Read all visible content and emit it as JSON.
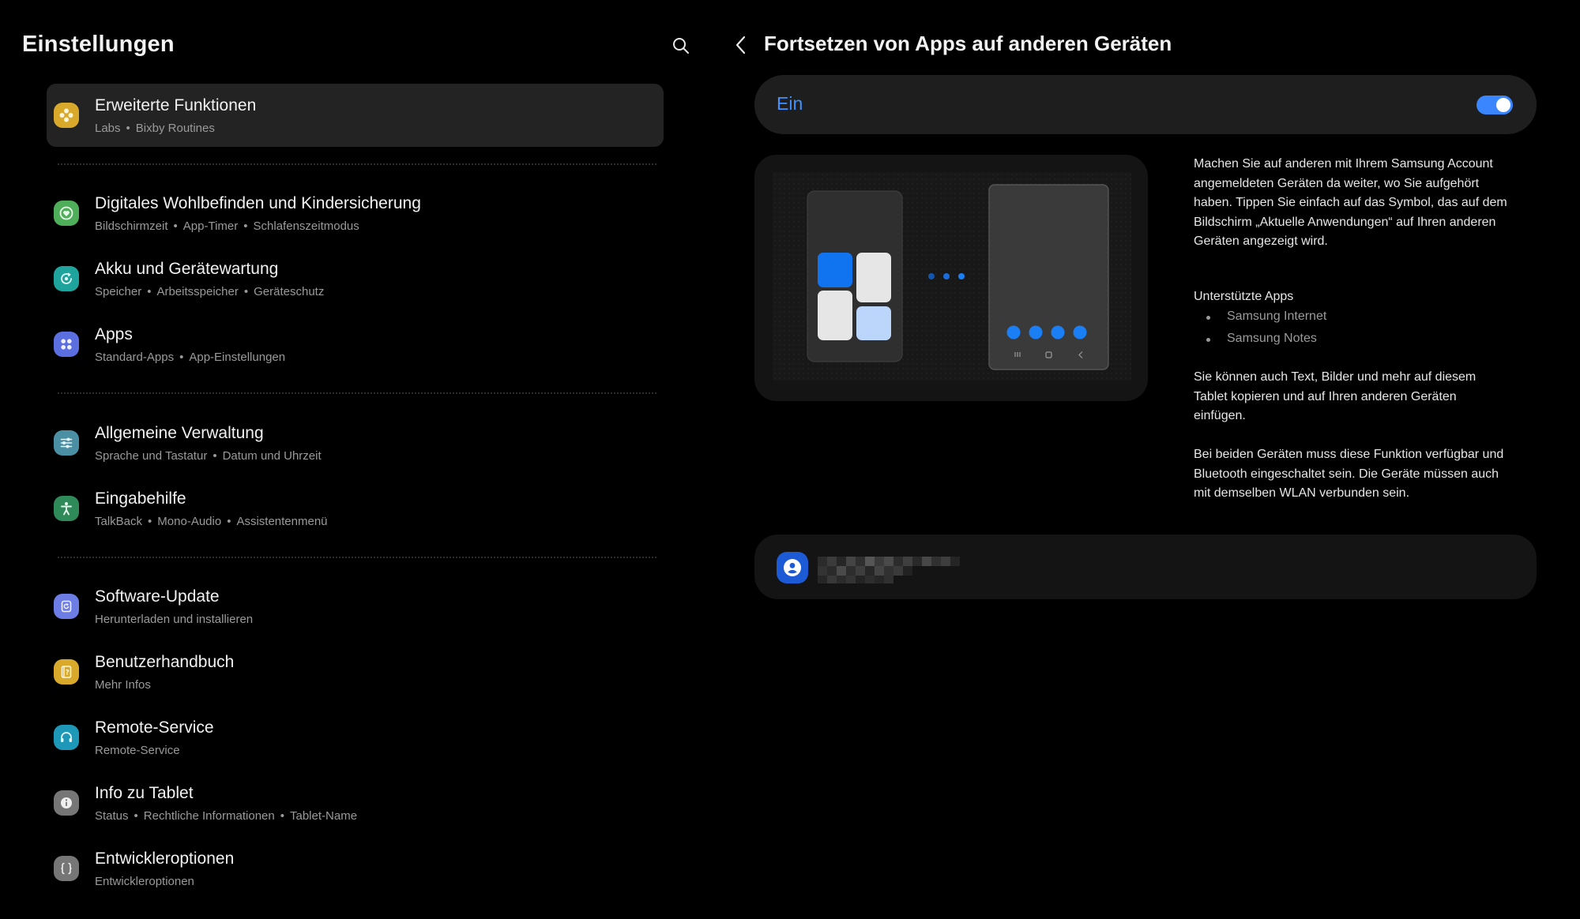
{
  "left": {
    "title": "Einstellungen",
    "search_icon": "search-icon",
    "items": [
      {
        "name": "erweiterte-funktionen",
        "title": "Erweiterte Funktionen",
        "subs": [
          "Labs",
          "Bixby Routines"
        ],
        "icon": "gear-flower-icon",
        "color": "#d9a92c",
        "selected": true
      },
      {
        "name": "digitales-wohlbefinden",
        "title": "Digitales Wohlbefinden und Kindersicherung",
        "subs": [
          "Bildschirmzeit",
          "App-Timer",
          "Schlafenszeitmodus"
        ],
        "icon": "heart-circle-icon",
        "color": "#4fae5a",
        "selected": false
      },
      {
        "name": "akku",
        "title": "Akku und Gerätewartung",
        "subs": [
          "Speicher",
          "Arbeitsspeicher",
          "Geräteschutz"
        ],
        "icon": "device-care-icon",
        "color": "#1fa39d",
        "selected": false
      },
      {
        "name": "apps",
        "title": "Apps",
        "subs": [
          "Standard-Apps",
          "App-Einstellungen"
        ],
        "icon": "apps-grid-icon",
        "color": "#5b6fe0",
        "selected": false
      },
      {
        "name": "allgemeine-verwaltung",
        "title": "Allgemeine Verwaltung",
        "subs": [
          "Sprache und Tastatur",
          "Datum und Uhrzeit"
        ],
        "icon": "sliders-icon",
        "color": "#4a8fa3",
        "selected": false
      },
      {
        "name": "eingabehilfe",
        "title": "Eingabehilfe",
        "subs": [
          "TalkBack",
          "Mono-Audio",
          "Assistentenmenü"
        ],
        "icon": "accessibility-icon",
        "color": "#2f8a5a",
        "selected": false
      },
      {
        "name": "software-update",
        "title": "Software-Update",
        "subs": [
          "Herunterladen und installieren"
        ],
        "icon": "update-icon",
        "color": "#6d7de6",
        "selected": false
      },
      {
        "name": "benutzerhandbuch",
        "title": "Benutzerhandbuch",
        "subs": [
          "Mehr Infos"
        ],
        "icon": "manual-book-icon",
        "color": "#d9a92c",
        "selected": false
      },
      {
        "name": "remote-service",
        "title": "Remote-Service",
        "subs": [
          "Remote-Service"
        ],
        "icon": "headset-icon",
        "color": "#1e98b8",
        "selected": false
      },
      {
        "name": "info-zu-tablet",
        "title": "Info zu Tablet",
        "subs": [
          "Status",
          "Rechtliche Informationen",
          "Tablet-Name"
        ],
        "icon": "info-icon",
        "color": "#767676",
        "selected": false
      },
      {
        "name": "entwickleroptionen",
        "title": "Entwickleroptionen",
        "subs": [
          "Entwickleroptionen"
        ],
        "icon": "braces-icon",
        "color": "#767676",
        "selected": false
      }
    ]
  },
  "right": {
    "title": "Fortsetzen von Apps auf anderen Geräten",
    "back_icon": "back-chevron-icon",
    "toggle": {
      "label": "Ein",
      "state": "on",
      "color": "#3a86ff"
    },
    "description_1": "Machen Sie auf anderen mit Ihrem Samsung Account angemeldeten Geräten da weiter, wo Sie aufgehört haben. Tippen Sie einfach auf das Symbol, das auf dem Bildschirm „Aktuelle Anwendungen“ auf Ihren anderen Geräten angezeigt wird.",
    "supported_heading": "Unterstützte Apps",
    "supported_apps": [
      "Samsung Internet",
      "Samsung Notes"
    ],
    "description_2": "Sie können auch Text, Bilder und mehr auf diesem Tablet kopieren und auf Ihren anderen Geräten einfügen.",
    "description_3": "Bei beiden Geräten muss diese Funktion verfügbar und Bluetooth eingeschaltet sein. Die Geräte müssen auch mit demselben WLAN verbunden sein.",
    "account_icon": "account-icon"
  }
}
